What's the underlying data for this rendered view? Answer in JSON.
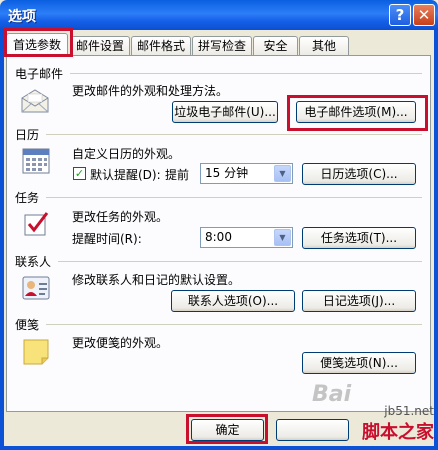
{
  "window": {
    "title": "选项",
    "help_glyph": "?",
    "close_glyph": "✕"
  },
  "tabs": [
    {
      "label": "首选参数"
    },
    {
      "label": "邮件设置"
    },
    {
      "label": "邮件格式"
    },
    {
      "label": "拼写检查"
    },
    {
      "label": "安全"
    },
    {
      "label": "其他"
    }
  ],
  "email": {
    "title": "电子邮件",
    "desc": "更改邮件的外观和处理方法。",
    "junk_button": "垃圾电子邮件(U)...",
    "options_button": "电子邮件选项(M)..."
  },
  "calendar": {
    "title": "日历",
    "desc": "自定义日历的外观。",
    "reminder_label": "默认提醒(D):",
    "reminder_checked": true,
    "before_label": "提前",
    "reminder_value": "15 分钟",
    "options_button": "日历选项(C)..."
  },
  "tasks": {
    "title": "任务",
    "desc": "更改任务的外观。",
    "reminder_time_label": "提醒时间(R):",
    "reminder_time_value": "8:00",
    "options_button": "任务选项(T)..."
  },
  "contacts": {
    "title": "联系人",
    "desc": "修改联系人和日记的默认设置。",
    "contact_options_button": "联系人选项(O)...",
    "journal_options_button": "日记选项(J)..."
  },
  "notes": {
    "title": "便笺",
    "desc": "更改便笺的外观。",
    "options_button": "便笺选项(N)..."
  },
  "footer": {
    "ok_button": "确定"
  },
  "watermark": {
    "baidu": "Bai",
    "url": "jb51.net",
    "brand": "脚本之家"
  },
  "colors": {
    "title_bar": "#0a5fe0",
    "highlight": "#c8102e"
  }
}
